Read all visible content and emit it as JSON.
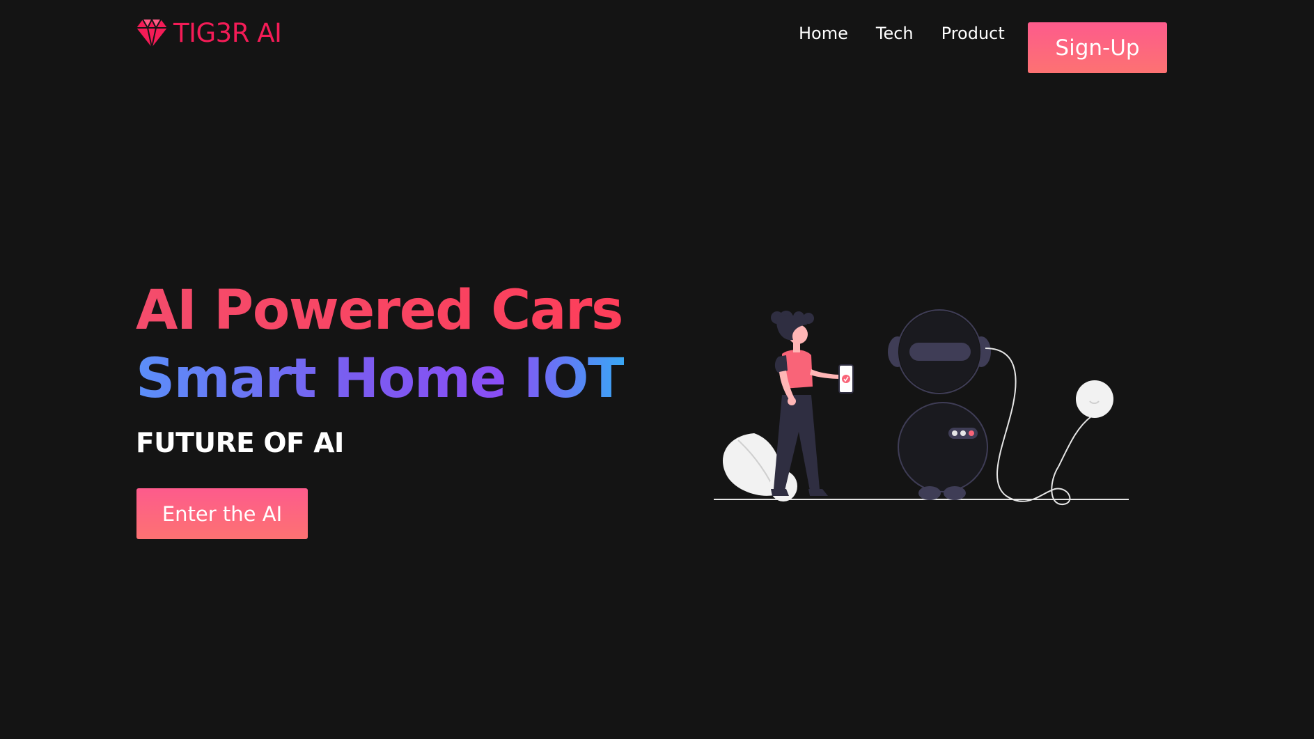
{
  "navbar": {
    "logo_text": "TIG3R AI",
    "logo_icon": "diamond-icon",
    "links": [
      "Home",
      "Tech",
      "Product"
    ],
    "signup_label": "Sign-Up"
  },
  "hero": {
    "line1": "AI Powered Cars",
    "line2": "Smart Home IOT",
    "subtitle": "FUTURE OF AI",
    "cta_label": "Enter the AI"
  },
  "illustration": {
    "description_icon": "woman-with-robot-illustration"
  },
  "colors": {
    "background": "#141414",
    "brand": "#f41c57",
    "button_top": "#fd5b8c",
    "button_bottom": "#fd7272",
    "line1_gradient": [
      "#f44c6c",
      "#fd3e5a"
    ],
    "line2_gradient": [
      "#5b8ff9",
      "#8a4ef5",
      "#3aa7f5"
    ],
    "illustration_accent": "#f96478",
    "illustration_dark": "#2f2e41"
  }
}
